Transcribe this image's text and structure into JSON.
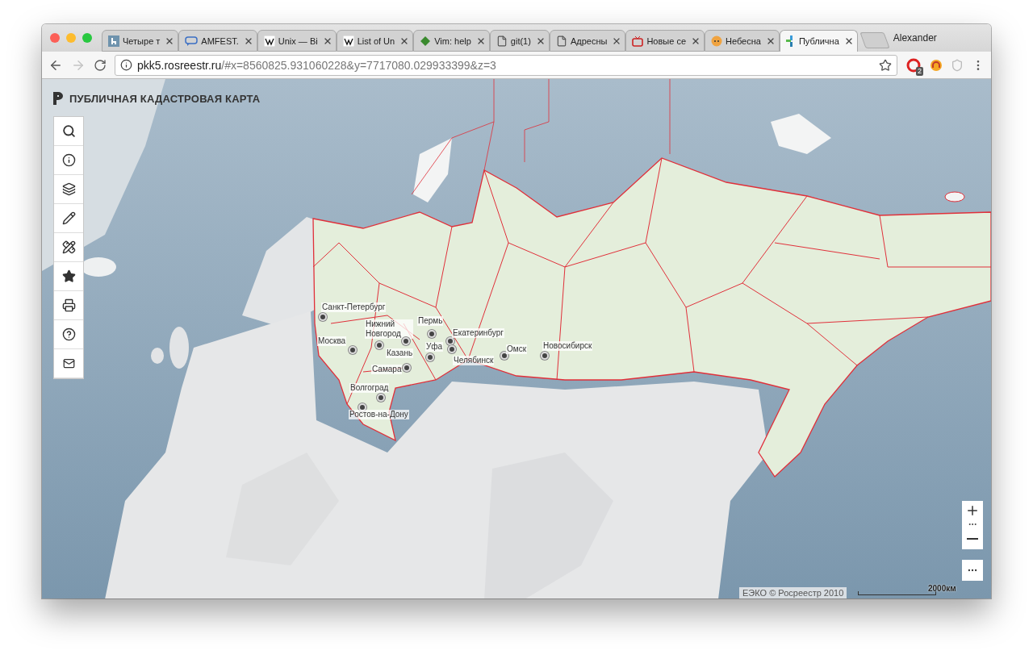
{
  "browser": {
    "tabs": [
      {
        "title": "Четыре т",
        "kind": "letter",
        "selected": false
      },
      {
        "title": "AMFEST.",
        "kind": "bubble",
        "selected": false
      },
      {
        "title": "Unix — Bi",
        "kind": "wiki",
        "selected": false
      },
      {
        "title": "List of Un",
        "kind": "wiki",
        "selected": false
      },
      {
        "title": "Vim: help",
        "kind": "vim",
        "selected": false
      },
      {
        "title": "git(1)",
        "kind": "doc",
        "selected": false
      },
      {
        "title": "Адресны",
        "kind": "doc",
        "selected": false
      },
      {
        "title": "Новые се",
        "kind": "tv",
        "selected": false
      },
      {
        "title": "Небесна",
        "kind": "cat",
        "selected": false
      },
      {
        "title": "Публична",
        "kind": "pkk",
        "selected": true
      }
    ],
    "profile": "Alexander",
    "address": {
      "host": "pkk5.rosreestr.ru",
      "rest": "/#x=8560825.931060228&y=7717080.029933399&z=3"
    },
    "extension_badge": "2"
  },
  "map": {
    "title": "ПУБЛИЧНАЯ КАДАСТРОВАЯ КАРТА",
    "cities": [
      {
        "name": "Санкт-Петербург"
      },
      {
        "name": "Нижний Новгород"
      },
      {
        "name": "Пермь"
      },
      {
        "name": "Екатеринбург"
      },
      {
        "name": "Москва"
      },
      {
        "name": "Казань"
      },
      {
        "name": "Уфа"
      },
      {
        "name": "Челябинск"
      },
      {
        "name": "Омск"
      },
      {
        "name": "Новосибирск"
      },
      {
        "name": "Самара"
      },
      {
        "name": "Волгоград"
      },
      {
        "name": "Ростов-на-Дону"
      }
    ],
    "attribution": "ЕЭКО © Росреестр 2010",
    "scale": "2000км"
  }
}
